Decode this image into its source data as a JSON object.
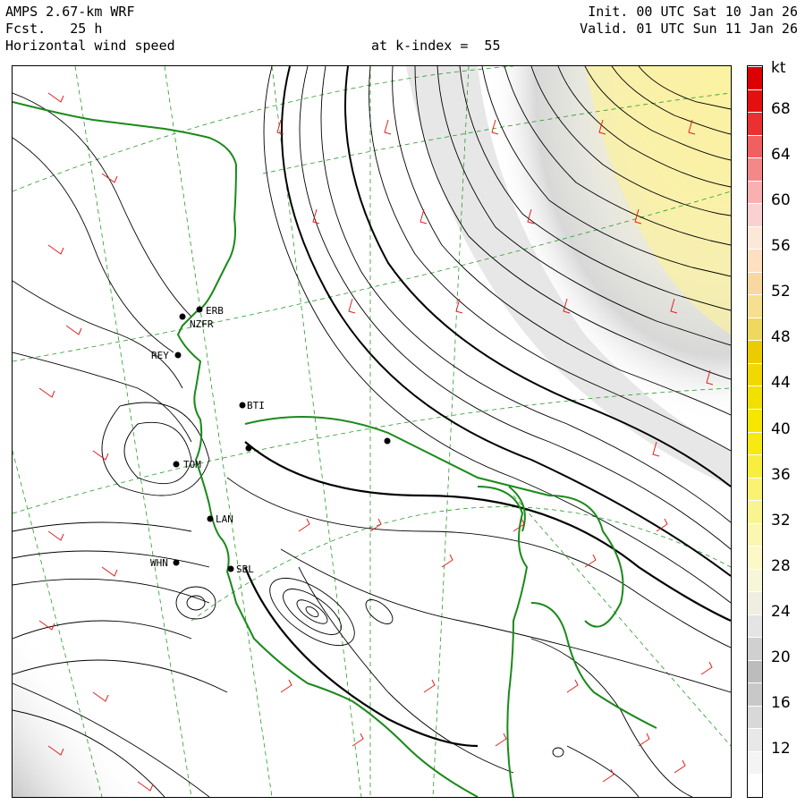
{
  "header": {
    "model": "AMPS 2.67-km WRF",
    "forecast": "Fcst.   25 h",
    "field": "Horizontal wind speed",
    "level": "at k-index =  55",
    "init": "Init. 00 UTC Sat 10 Jan 26",
    "valid": "Valid. 01 UTC Sun 11 Jan 26"
  },
  "colorbar": {
    "unit": "kt",
    "ticks": [
      "68",
      "64",
      "60",
      "56",
      "52",
      "48",
      "44",
      "40",
      "36",
      "32",
      "28",
      "24",
      "20",
      "16",
      "12"
    ],
    "bands": [
      {
        "from": 8,
        "to": 10,
        "color": "#ffffff"
      },
      {
        "from": 10,
        "to": 12,
        "color": "#f4f4f4"
      },
      {
        "from": 12,
        "to": 14,
        "color": "#e8e8e8"
      },
      {
        "from": 14,
        "to": 16,
        "color": "#d8d8d8"
      },
      {
        "from": 16,
        "to": 18,
        "color": "#c8c8c8"
      },
      {
        "from": 18,
        "to": 20,
        "color": "#bcbcbc"
      },
      {
        "from": 20,
        "to": 22,
        "color": "#d0d0d0"
      },
      {
        "from": 22,
        "to": 24,
        "color": "#e4e4e4"
      },
      {
        "from": 24,
        "to": 26,
        "color": "#efeee0"
      },
      {
        "from": 26,
        "to": 28,
        "color": "#f8f6d8"
      },
      {
        "from": 28,
        "to": 30,
        "color": "#fcf8c8"
      },
      {
        "from": 30,
        "to": 32,
        "color": "#fbf6b0"
      },
      {
        "from": 32,
        "to": 34,
        "color": "#faf490"
      },
      {
        "from": 34,
        "to": 36,
        "color": "#faf270"
      },
      {
        "from": 36,
        "to": 38,
        "color": "#f8ee40"
      },
      {
        "from": 38,
        "to": 40,
        "color": "#f6ea10"
      },
      {
        "from": 40,
        "to": 42,
        "color": "#f6e600"
      },
      {
        "from": 42,
        "to": 44,
        "color": "#f2e000"
      },
      {
        "from": 44,
        "to": 46,
        "color": "#f0d800"
      },
      {
        "from": 46,
        "to": 48,
        "color": "#eccc00"
      },
      {
        "from": 48,
        "to": 50,
        "color": "#f0d860"
      },
      {
        "from": 50,
        "to": 52,
        "color": "#f4e090"
      },
      {
        "from": 52,
        "to": 54,
        "color": "#f8d8a0"
      },
      {
        "from": 54,
        "to": 56,
        "color": "#fce0c0"
      },
      {
        "from": 56,
        "to": 58,
        "color": "#fce8d8"
      },
      {
        "from": 58,
        "to": 60,
        "color": "#fad0d0"
      },
      {
        "from": 60,
        "to": 62,
        "color": "#f8b0b0"
      },
      {
        "from": 62,
        "to": 64,
        "color": "#f48888"
      },
      {
        "from": 64,
        "to": 66,
        "color": "#f06060"
      },
      {
        "from": 66,
        "to": 68,
        "color": "#ea3030"
      },
      {
        "from": 68,
        "to": 70,
        "color": "#e41010"
      },
      {
        "from": 70,
        "to": 72,
        "color": "#dd0000"
      }
    ]
  },
  "stations": [
    {
      "id": "ERB",
      "label": "ERB"
    },
    {
      "id": "NZFR",
      "label": "NZFR"
    },
    {
      "id": "REY",
      "label": "REY"
    },
    {
      "id": "BTI",
      "label": "BTI"
    },
    {
      "id": "TOM",
      "label": "TOM"
    },
    {
      "id": "LAN",
      "label": "LAN"
    },
    {
      "id": "WHN",
      "label": "WHN"
    },
    {
      "id": "SBL",
      "label": "SBL"
    }
  ],
  "colors": {
    "coastline": "#1a8a1a",
    "graticule": "#2a9a2a",
    "barbs": "#e02020",
    "streamlines": "#000000"
  }
}
